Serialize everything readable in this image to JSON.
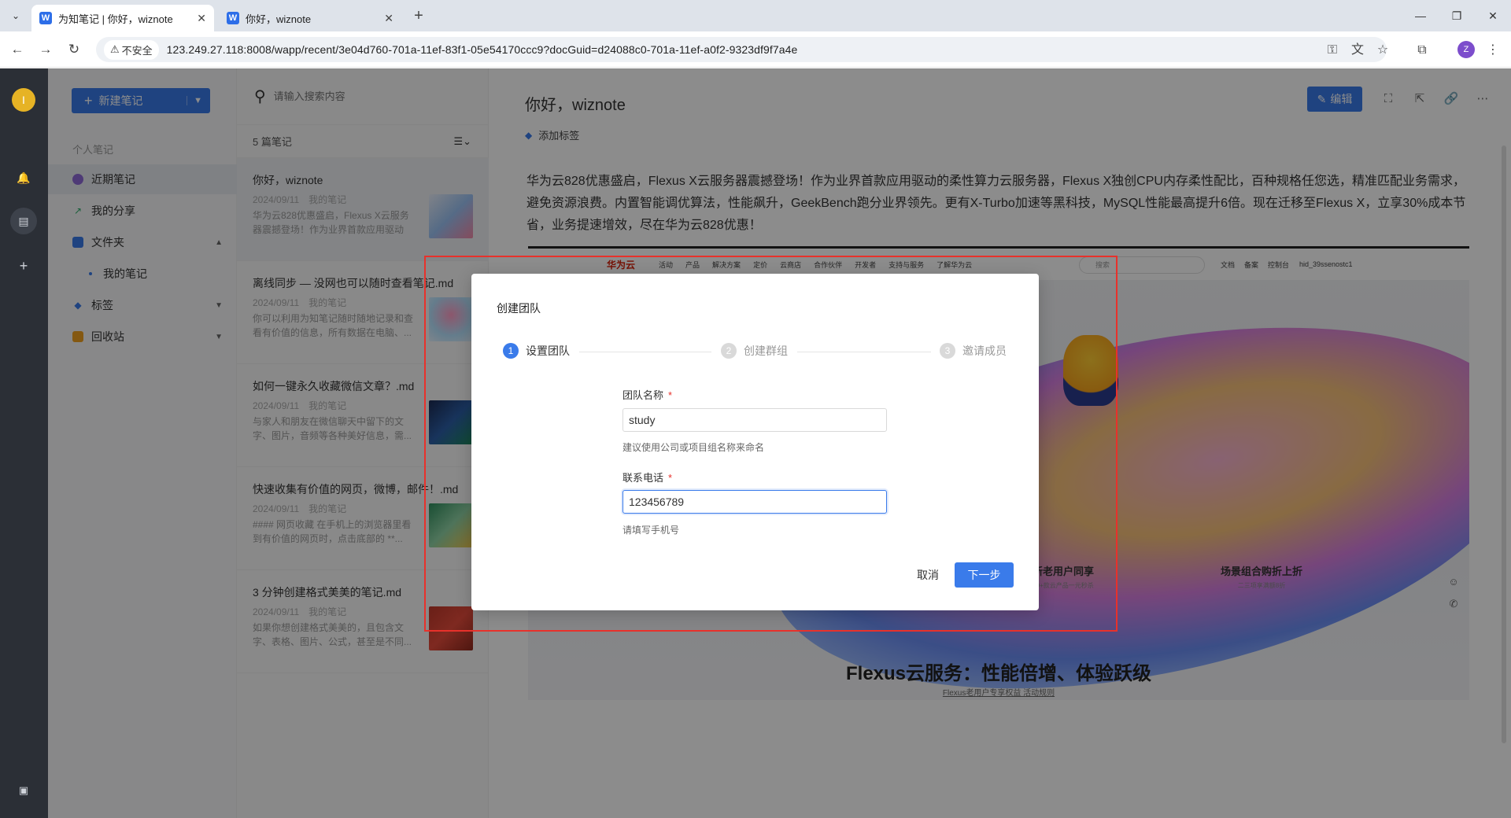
{
  "browser": {
    "tabs": [
      {
        "title": "为知笔记 | 你好，wiznote",
        "active": true
      },
      {
        "title": "你好，wiznote",
        "active": false
      }
    ],
    "favicon_letter": "W",
    "insecure_label": "不安全",
    "url": "123.249.27.118:8008/wapp/recent/3e04d760-701a-11ef-83f1-05e54170ccc9?docGuid=d24088c0-701a-11ef-a0f2-9323df9f7a4e",
    "profile_initial": "Z"
  },
  "rail": {
    "avatar_initial": "I"
  },
  "sidebar": {
    "new_note_label": "新建笔记",
    "section_label": "个人笔记",
    "items": [
      {
        "label": "近期笔记",
        "color": "#8e6ad8"
      },
      {
        "label": "我的分享",
        "color": "#2fae6b"
      },
      {
        "label": "文件夹",
        "color": "#3a7bea"
      },
      {
        "label": "我的笔记"
      },
      {
        "label": "标签",
        "color": "#3a7bea"
      },
      {
        "label": "回收站",
        "color": "#f0a020"
      }
    ]
  },
  "notelist": {
    "search_placeholder": "请输入搜索内容",
    "count_label": "5 篇笔记",
    "notes": [
      {
        "title": "你好，wiznote",
        "date": "2024/09/11",
        "folder": "我的笔记",
        "excerpt": "华为云828优惠盛启，Flexus X云服务器震撼登场！作为业界首款应用驱动的..."
      },
      {
        "title": "离线同步 — 没网也可以随时查看笔记.md",
        "date": "2024/09/11",
        "folder": "我的笔记",
        "excerpt": "你可以利用为知笔记随时随地记录和查看有价值的信息，所有数据在电脑、..."
      },
      {
        "title": "如何一键永久收藏微信文章？.md",
        "date": "2024/09/11",
        "folder": "我的笔记",
        "excerpt": "与家人和朋友在微信聊天中留下的文字、图片，音频等各种美好信息，需..."
      },
      {
        "title": "快速收集有价值的网页，微博，邮件！.md",
        "date": "2024/09/11",
        "folder": "我的笔记",
        "excerpt": "#### 网页收藏 在手机上的浏览器里看到有价值的网页时，点击底部的 **..."
      },
      {
        "title": "3 分钟创建格式美美的笔记.md",
        "date": "2024/09/11",
        "folder": "我的笔记",
        "excerpt": "如果你想创建格式美美的，且包含文字、表格、图片、公式，甚至是不同..."
      }
    ]
  },
  "editor": {
    "title": "你好，wiznote",
    "add_tag_label": "添加标签",
    "edit_label": "编辑",
    "body": "华为云828优惠盛启，Flexus X云服务器震撼登场！作为业界首款应用驱动的柔性算力云服务器，Flexus X独创CPU内存柔性配比，百种规格任您选，精准匹配业务需求，避免资源浪费。内置智能调优算法，性能飙升，GeekBench跑分业界领先。更有X-Turbo加速等黑科技，MySQL性能最高提升6倍。现在迁移至Flexus X，立享30%成本节省，业务提速增效，尽在华为云828优惠！",
    "image": {
      "logo": "华为云",
      "nav": [
        "活动",
        "产品",
        "解决方案",
        "定价",
        "云商店",
        "合作伙伴",
        "开发者",
        "支持与服务",
        "了解华为云"
      ],
      "search_placeholder": "搜索",
      "user_links": [
        "文档",
        "备案",
        "控制台",
        "hid_39ssenostc1"
      ],
      "promo1_title": "新老用户同享",
      "promo1_sub": "50+款云产品一元秒杀",
      "promo2_title": "场景组合购折上折",
      "promo2_sub": "二三项享满额8折",
      "heading": "Flexus云服务：性能倍增、体验跃级",
      "subheading": "Flexus老用户专享权益 活动规则"
    }
  },
  "dialog": {
    "title": "创建团队",
    "steps": [
      {
        "num": "1",
        "label": "设置团队",
        "state": "done"
      },
      {
        "num": "2",
        "label": "创建群组",
        "state": "todo"
      },
      {
        "num": "3",
        "label": "邀请成员",
        "state": "todo"
      }
    ],
    "team_name_label": "团队名称",
    "team_name_value": "study",
    "team_name_hint": "建议使用公司或项目组名称来命名",
    "phone_label": "联系电话",
    "phone_value": "123456789",
    "phone_hint": "请填写手机号",
    "required_mark": "*",
    "cancel_label": "取消",
    "next_label": "下一步"
  },
  "colors": {
    "accent": "#3a7bea",
    "highlight_box": "#e8312b"
  }
}
